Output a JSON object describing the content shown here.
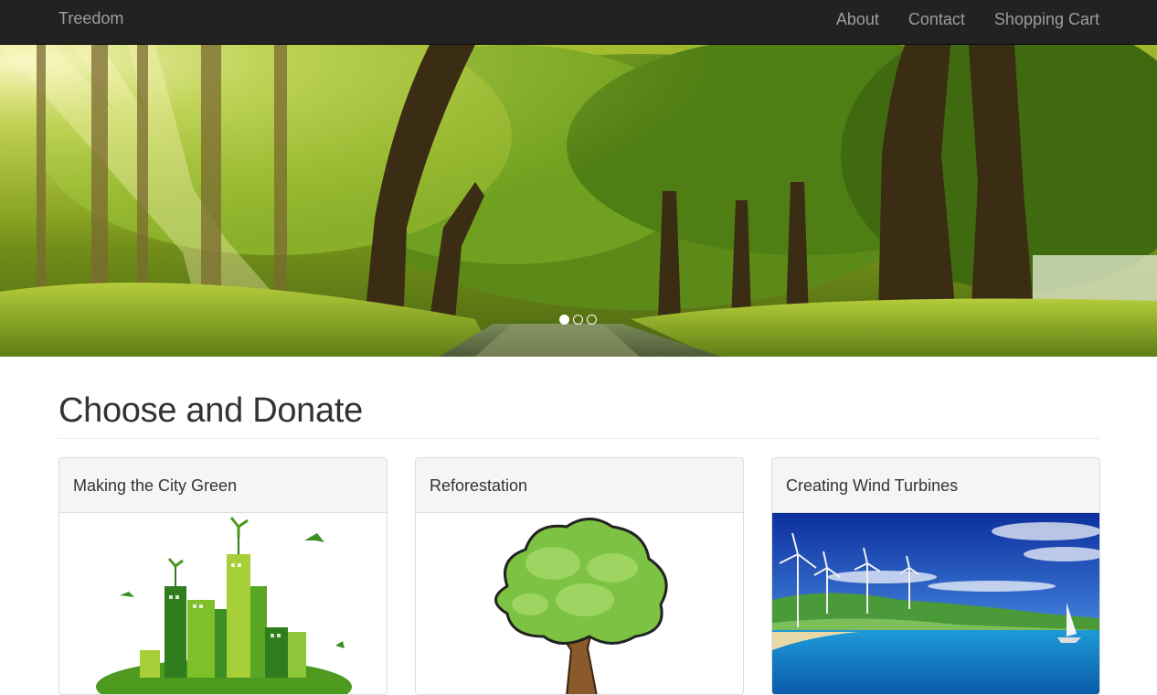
{
  "navbar": {
    "brand": "Treedom",
    "links": [
      {
        "label": "About"
      },
      {
        "label": "Contact"
      },
      {
        "label": "Shopping Cart"
      }
    ]
  },
  "hero": {
    "image": "forest-road-image",
    "slides": 3,
    "active_slide": 1
  },
  "section": {
    "title": "Choose and Donate"
  },
  "cards": [
    {
      "title": "Making the City Green",
      "image": "green-city-illustration"
    },
    {
      "title": "Reforestation",
      "image": "tree-illustration"
    },
    {
      "title": "Creating Wind Turbines",
      "image": "wind-turbines-seascape"
    }
  ],
  "colors": {
    "navbar_bg": "#222222",
    "nav_text": "#9d9d9d",
    "card_header_bg": "#f5f5f5",
    "border": "#dddddd"
  }
}
